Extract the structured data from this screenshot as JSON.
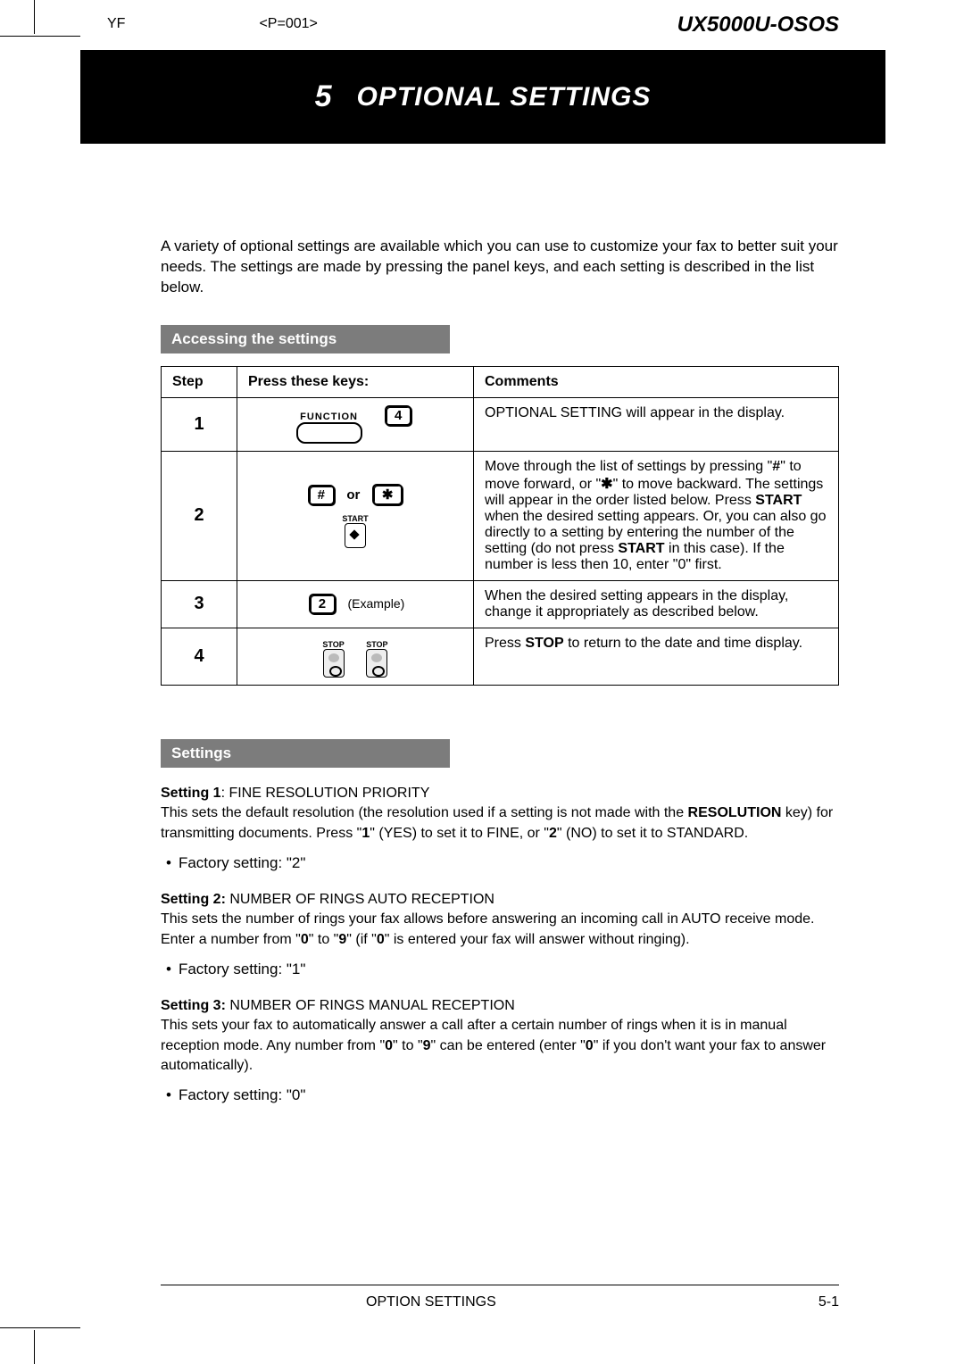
{
  "meta": {
    "code": "YF",
    "page_id": "<P=001>",
    "model": "UX5000U-OSOS"
  },
  "chapter": {
    "number": "5",
    "title": "OPTIONAL SETTINGS"
  },
  "intro": "A variety of optional settings are available which you can use to customize your fax to better suit your needs. The settings are made by pressing the panel keys, and each setting is described in the list below.",
  "section1": {
    "heading": "Accessing the settings"
  },
  "table": {
    "headers": {
      "step": "Step",
      "keys": "Press these keys:",
      "comments": "Comments"
    },
    "rows": [
      {
        "step": "1",
        "keys": {
          "function_label": "FUNCTION",
          "digit": "4"
        },
        "comment_html": "OPTIONAL SETTING will appear in the display."
      },
      {
        "step": "2",
        "keys": {
          "key1": "#",
          "or": "or",
          "key2": "✱",
          "start_label": "START"
        },
        "comment_html": "Move through the list of settings by pressing \"<b>#</b>\" to move forward, or \"<b>✱</b>\" to move backward. The settings will appear in the order listed below. Press <b>START</b> when the desired setting appears. Or, you can also go directly to a setting by entering the number of the setting (do not press <b>START</b> in this case). If the number is less then 10, enter \"0\" first."
      },
      {
        "step": "3",
        "keys": {
          "digit": "2",
          "example": "(Example)"
        },
        "comment_html": "When the desired setting appears in the display, change it appropriately as described below."
      },
      {
        "step": "4",
        "keys": {
          "stop_label": "STOP"
        },
        "comment_html": "Press <b>STOP</b> to return to the date and time display."
      }
    ]
  },
  "section2": {
    "heading": "Settings"
  },
  "settings": [
    {
      "title": "Setting 1",
      "name": ": FINE RESOLUTION PRIORITY",
      "body_html": "This sets the default resolution (the resolution used if a setting is not made with the <b>RESOLUTION</b> key) for transmitting documents. Press \"<b>1</b>\" (YES) to set it to FINE, or \"<b>2</b>\" (NO) to set it to STANDARD.",
      "factory": "Factory setting:  \"2\""
    },
    {
      "title": "Setting 2:",
      "name": " NUMBER OF RINGS AUTO RECEPTION",
      "body_html": "This sets the number of rings your fax allows before answering an incoming call in AUTO receive mode. Enter a number from \"<b>0</b>\" to \"<b>9</b>\"  (if \"<b>0</b>\" is entered your fax will answer without ringing).",
      "factory": "Factory setting:  \"1\""
    },
    {
      "title": "Setting 3:",
      "name": " NUMBER OF RINGS MANUAL RECEPTION",
      "body_html": "This sets your fax to automatically answer a call after a certain number of rings when it is in manual reception mode. Any number from \"<b>0</b>\" to \"<b>9</b>\" can be entered (enter \"<b>0</b>\" if you don't want your fax to answer automatically).",
      "factory": "Factory setting:  \"0\""
    }
  ],
  "footer": {
    "title": "OPTION SETTINGS",
    "page": "5-1"
  }
}
